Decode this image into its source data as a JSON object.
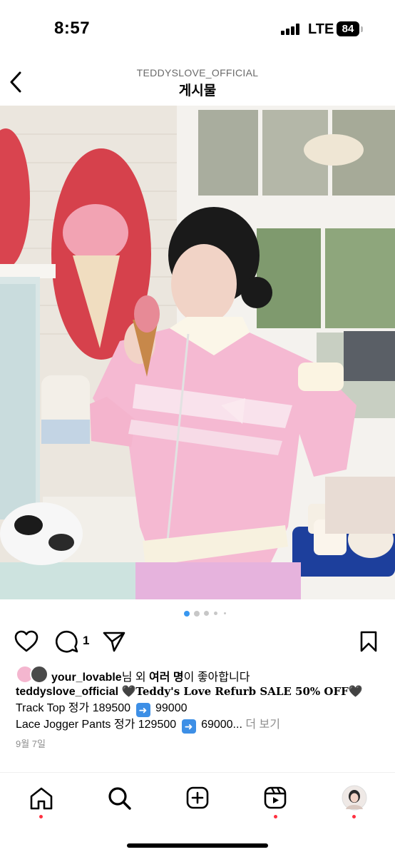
{
  "status_bar": {
    "time": "8:57",
    "network": "LTE",
    "battery": "84"
  },
  "header": {
    "account": "TEDDYSLOVE_OFFICIAL",
    "title": "게시물"
  },
  "post": {
    "image_description": "Woman in pink zip-up track jacket holding an ice cream cone in a pastel ice cream parlor",
    "carousel": {
      "total": 5,
      "active": 1
    },
    "comment_count": "1",
    "likes": {
      "user": "your_lovable",
      "suffix_1": "님 외 ",
      "bold": "여러 명",
      "suffix_2": "이 좋아합니다"
    },
    "caption": {
      "username": "teddyslove_official",
      "heart_1": "🖤",
      "headline": "Teddy's Love Refurb SALE 50% OFF",
      "heart_2": "🖤",
      "line2_label": "Track Top 정가 189500",
      "line2_price": "99000",
      "line3_label": "Lace Jogger Pants 정가 129500",
      "line3_price": "69000...",
      "more": "더 보기"
    },
    "date": "9월 7일"
  },
  "nav": {
    "items": [
      "home",
      "search",
      "create",
      "reels",
      "profile"
    ]
  },
  "colors": {
    "notification": "#ff3040",
    "active_dot": "#3897f0",
    "muted_text": "#8e8e8e"
  },
  "icons": {
    "back": "chevron-left-icon",
    "heart": "heart-icon",
    "comment": "comment-icon",
    "share": "paper-plane-icon",
    "save": "bookmark-icon",
    "arrow": "right-arrow-emoji"
  }
}
